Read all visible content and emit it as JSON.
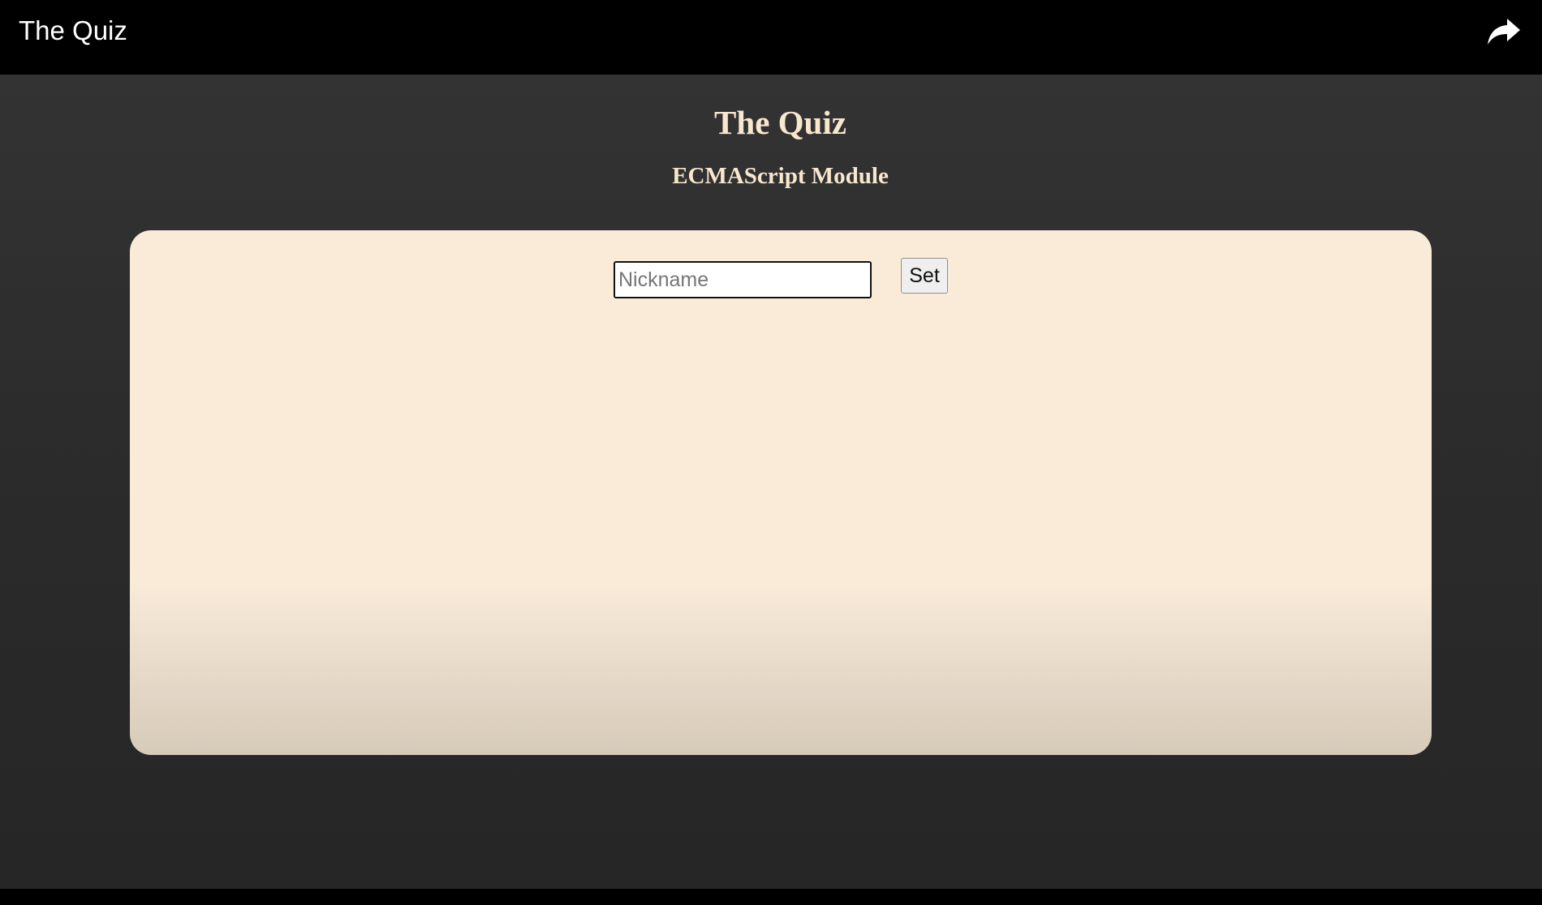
{
  "window": {
    "title": "The Quiz",
    "share_icon": "share-arrow-icon"
  },
  "header": {
    "title": "The Quiz",
    "subtitle": "ECMAScript Module"
  },
  "form": {
    "nickname_placeholder": "Nickname",
    "nickname_value": "",
    "set_label": "Set"
  },
  "colors": {
    "background": "#2f2f2f",
    "heading": "#f8e7cf",
    "panel": "#faebd9",
    "topbar": "#000000"
  }
}
